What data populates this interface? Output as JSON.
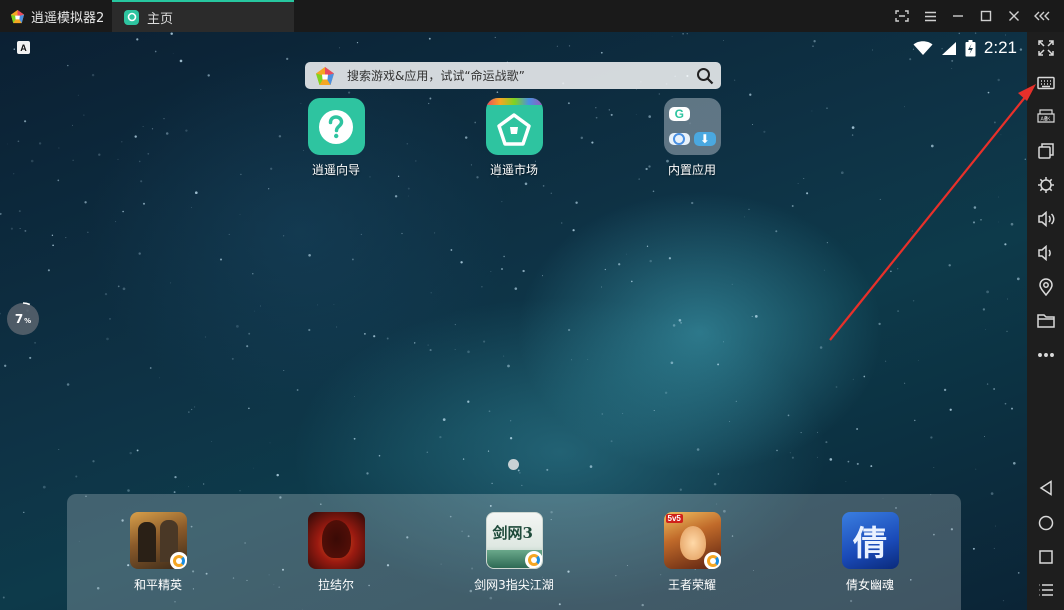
{
  "window": {
    "app_title": "逍遥模拟器2",
    "tab_home": "主页",
    "controls": [
      "screenshot-icon",
      "menu-icon",
      "minimize-icon",
      "maximize-icon",
      "close-icon",
      "collapse-icon"
    ]
  },
  "status_bar": {
    "indicator": "A",
    "time": "2:21",
    "icons": [
      "wifi-icon",
      "signal-icon",
      "battery-charging-icon"
    ]
  },
  "search": {
    "placeholder": "搜索游戏&应用，试试“命运战歌”"
  },
  "desktop_apps": [
    {
      "label": "逍遥向导",
      "icon": "question-icon",
      "color": "#2ec4a0"
    },
    {
      "label": "逍遥市场",
      "icon": "market-icon",
      "color": "#2ec4a0"
    },
    {
      "label": "内置应用",
      "icon": "folder-icon",
      "color": "#5a6b78"
    }
  ],
  "progress": {
    "value": "7",
    "unit": "%",
    "fraction": 0.07
  },
  "dock_apps": [
    {
      "label": "和平精英",
      "icon": "game-icon"
    },
    {
      "label": "拉结尔",
      "icon": "game-icon"
    },
    {
      "label": "剑网3指尖江湖",
      "icon": "game-icon",
      "icon_text": "剑网3"
    },
    {
      "label": "王者荣耀",
      "icon": "game-icon"
    },
    {
      "label": "倩女幽魂",
      "icon": "game-icon",
      "icon_text": "倩"
    }
  ],
  "sidebar": {
    "items": [
      "fullscreen-icon",
      "keyboard-icon",
      "apk-icon",
      "multi-window-icon",
      "settings-icon",
      "volume-up-icon",
      "volume-down-icon",
      "location-icon",
      "folder-icon",
      "more-icon",
      "back-icon",
      "home-icon",
      "recents-icon",
      "menu-icon"
    ]
  },
  "colors": {
    "accent": "#2ec4a0",
    "annotation": "#e8302a"
  }
}
